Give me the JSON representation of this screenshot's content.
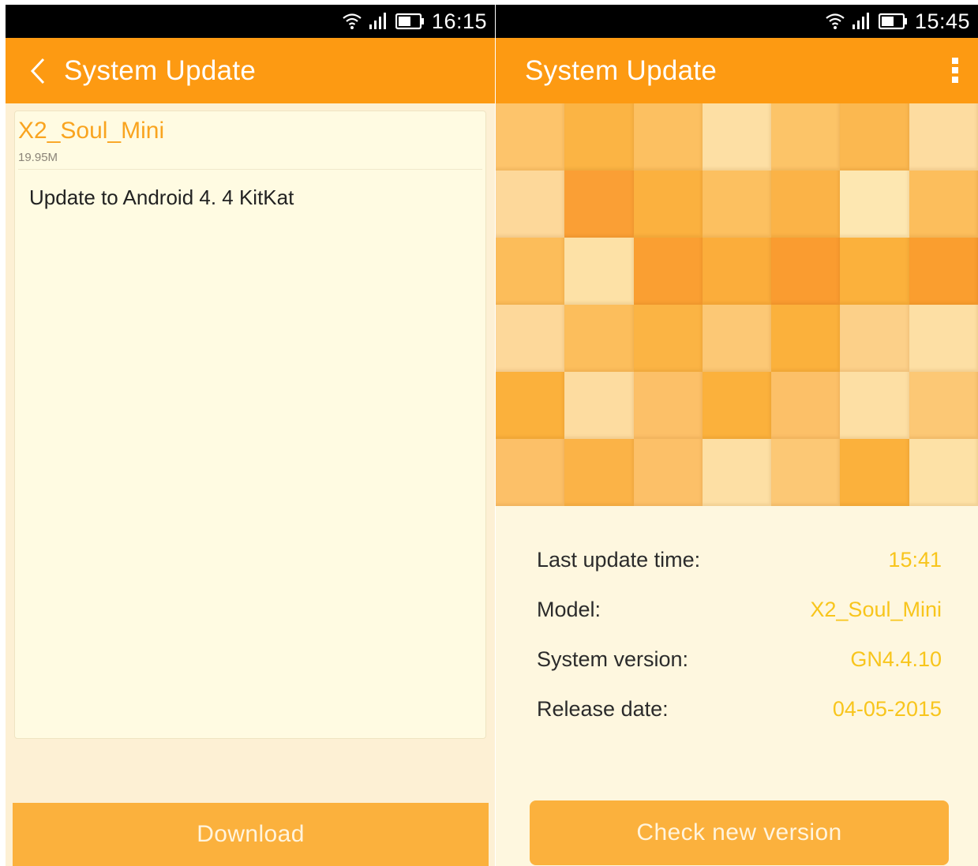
{
  "colors": {
    "status_bar": "#000000",
    "app_bar": "#fd9a12",
    "accent_text": "#f9a41f",
    "info_value": "#f8c51c",
    "button": "#fbb13d",
    "button_text": "#fff4dd",
    "left_background": "#fdf0d4",
    "right_background": "#fef7df"
  },
  "left": {
    "status": {
      "time": "16:15",
      "icons": [
        "wifi-icon",
        "signal-icon",
        "battery-icon"
      ]
    },
    "appbar": {
      "title": "System Update",
      "back_icon": "chevron-left-icon"
    },
    "card": {
      "title": "X2_Soul_Mini",
      "size": "19.95M",
      "description": "Update to Android 4. 4 KitKat"
    },
    "download_label": "Download"
  },
  "right": {
    "status": {
      "time": "15:45",
      "icons": [
        "wifi-icon",
        "signal-icon",
        "battery-icon"
      ]
    },
    "appbar": {
      "title": "System Update",
      "menu_icon": "more-vertical-icon"
    },
    "banner": {
      "columns": 7,
      "colors": [
        "#fdc46b",
        "#fbb444",
        "#fcc061",
        "#fddfa4",
        "#fcc468",
        "#fbb850",
        "#fddca0",
        "#fdd89a",
        "#fa9f35",
        "#fbb13f",
        "#fcc060",
        "#fbb347",
        "#fde7b1",
        "#fcbe5c",
        "#fcbd5a",
        "#fde1a6",
        "#fa9f32",
        "#fbad3b",
        "#fa9c30",
        "#fbb13c",
        "#fa9e2f",
        "#fdd89a",
        "#fcbe5c",
        "#fbb444",
        "#fcc875",
        "#fbb13c",
        "#fcd089",
        "#fddfa4",
        "#fbb13c",
        "#fddca0",
        "#fcc068",
        "#fbb13c",
        "#fcc068",
        "#fddfa4",
        "#fcc875",
        "#fcc068",
        "#fbb347",
        "#fcc068",
        "#fddfa4",
        "#fcc875",
        "#fbb13c",
        "#fde1a6"
      ]
    },
    "info": [
      {
        "label": "Last update time:",
        "value": "15:41"
      },
      {
        "label": "Model:",
        "value": "X2_Soul_Mini"
      },
      {
        "label": "System version:",
        "value": "GN4.4.10"
      },
      {
        "label": "Release date:",
        "value": "04-05-2015"
      }
    ],
    "check_label": "Check new version"
  }
}
